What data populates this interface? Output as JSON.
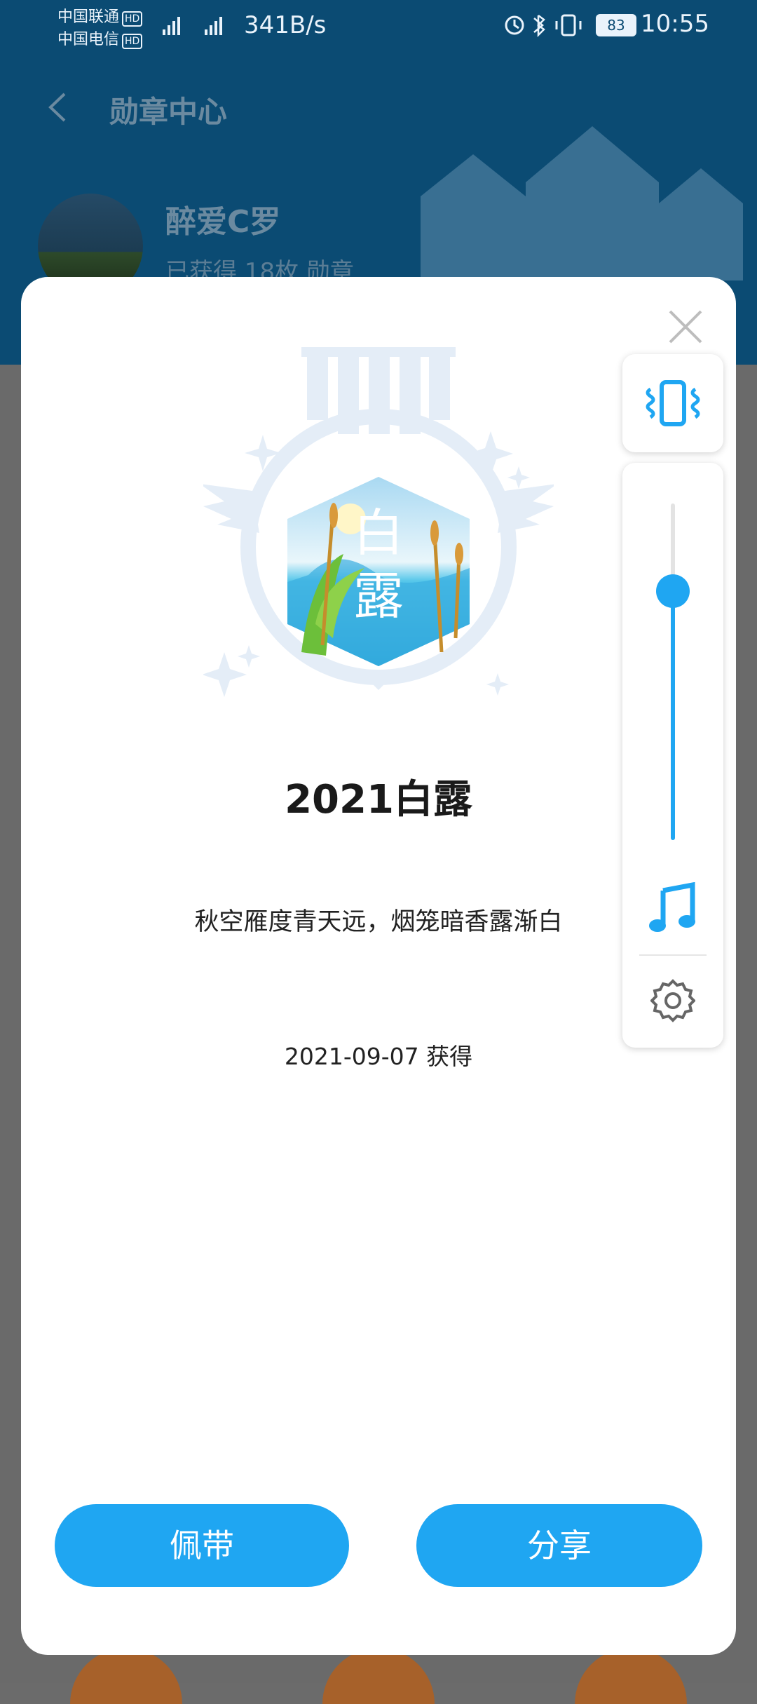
{
  "status_bar": {
    "carrier1": "中国联通",
    "carrier2": "中国电信",
    "hd_badge": "HD",
    "net_speed": "341B/s",
    "battery": "83",
    "time": "10:55"
  },
  "header": {
    "title": "勋章中心",
    "username": "醉爱C罗",
    "badge_count_text": "已获得 18枚 勋章"
  },
  "medal": {
    "emblem_text_top": "白",
    "emblem_text_bottom": "露",
    "title": "2021白露",
    "poem": "秋空雁度青天远，烟笼暗香露渐白",
    "date": "2021-09-07 获得"
  },
  "buttons": {
    "wear": "佩带",
    "share": "分享"
  },
  "volume_panel": {
    "level_fraction": 0.74,
    "accent_color": "#1fa6f2"
  },
  "icons": [
    "back-icon",
    "close-icon",
    "vibrate-icon",
    "music-note-icon",
    "gear-icon"
  ]
}
